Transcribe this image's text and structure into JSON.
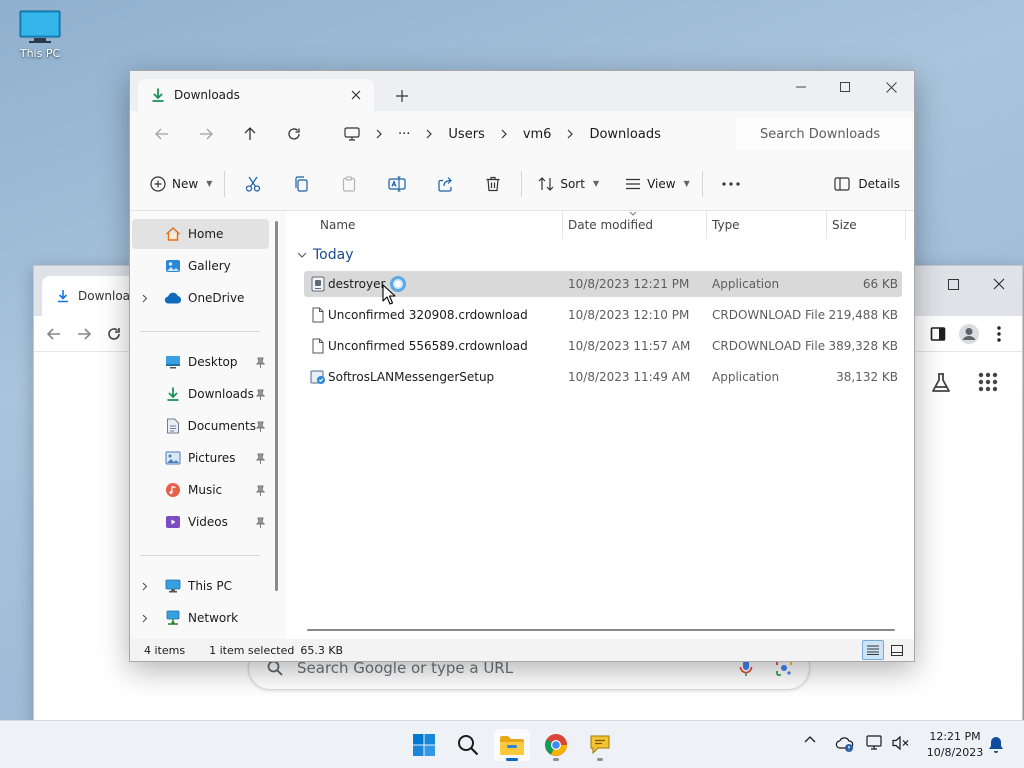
{
  "desktop": {
    "icon_label": "This PC"
  },
  "chrome": {
    "tab_title": "Downloads",
    "omnibox_placeholder": "Search Google or type a URL"
  },
  "explorer": {
    "tab_title": "Downloads",
    "breadcrumb": [
      "Users",
      "vm6",
      "Downloads"
    ],
    "search_placeholder": "Search Downloads",
    "commands": {
      "new_label": "New",
      "sort_label": "Sort",
      "view_label": "View",
      "details_label": "Details"
    },
    "nav": {
      "home": "Home",
      "gallery": "Gallery",
      "onedrive": "OneDrive",
      "desktop": "Desktop",
      "downloads": "Downloads",
      "documents": "Documents",
      "pictures": "Pictures",
      "music": "Music",
      "videos": "Videos",
      "thispc": "This PC",
      "network": "Network"
    },
    "columns": {
      "name": "Name",
      "date": "Date modified",
      "type": "Type",
      "size": "Size"
    },
    "group_label": "Today",
    "files": [
      {
        "name": "destroyer",
        "date": "10/8/2023 12:21 PM",
        "type": "Application",
        "size": "66 KB"
      },
      {
        "name": "Unconfirmed 320908.crdownload",
        "date": "10/8/2023 12:10 PM",
        "type": "CRDOWNLOAD File",
        "size": "219,488 KB"
      },
      {
        "name": "Unconfirmed 556589.crdownload",
        "date": "10/8/2023 11:57 AM",
        "type": "CRDOWNLOAD File",
        "size": "389,328 KB"
      },
      {
        "name": "SoftrosLANMessengerSetup",
        "date": "10/8/2023 11:49 AM",
        "type": "Application",
        "size": "38,132 KB"
      }
    ],
    "status": {
      "item_count": "4 items",
      "selection": "1 item selected",
      "selection_size": "65.3 KB"
    }
  },
  "taskbar": {
    "time": "12:21 PM",
    "date": "10/8/2023"
  },
  "colors": {
    "accent": "#0067c0",
    "selection": "#d9d9d9",
    "group_header": "#1b4d8c"
  }
}
